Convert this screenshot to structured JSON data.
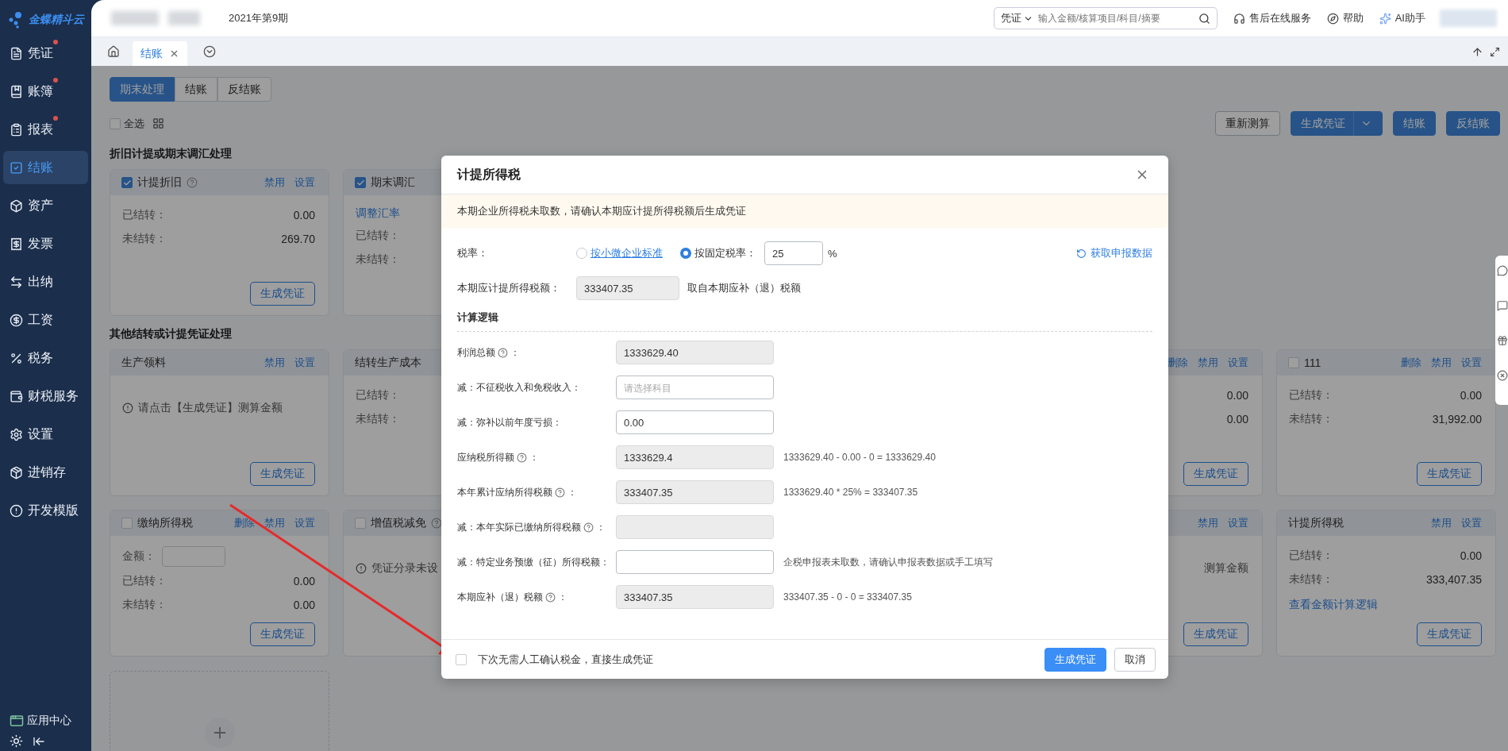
{
  "logo": {
    "text": "金蝶精斗云"
  },
  "sidebar": {
    "items": [
      {
        "label": "凭证",
        "badge": true,
        "selected": false
      },
      {
        "label": "账簿",
        "badge": true,
        "selected": false
      },
      {
        "label": "报表",
        "badge": true,
        "selected": false
      },
      {
        "label": "结账",
        "badge": false,
        "selected": true
      },
      {
        "label": "资产",
        "badge": false,
        "selected": false
      },
      {
        "label": "发票",
        "badge": false,
        "selected": false
      },
      {
        "label": "出纳",
        "badge": false,
        "selected": false
      },
      {
        "label": "工资",
        "badge": false,
        "selected": false
      },
      {
        "label": "税务",
        "badge": false,
        "selected": false
      },
      {
        "label": "财税服务",
        "badge": false,
        "selected": false
      },
      {
        "label": "设置",
        "badge": false,
        "selected": false
      },
      {
        "label": "进销存",
        "badge": false,
        "selected": false
      },
      {
        "label": "开发模版",
        "badge": false,
        "selected": false
      }
    ],
    "footer": {
      "label": "应用中心"
    }
  },
  "topbar": {
    "period": "2021年第9期",
    "search": {
      "scope": "凭证",
      "placeholder": "输入金额/核算项目/科目/摘要"
    },
    "links": [
      "售后在线服务",
      "帮助",
      "AI助手"
    ]
  },
  "tabs": [
    {
      "label": "结账",
      "selected": true
    }
  ],
  "mode_tabs": [
    {
      "label": "期末处理",
      "selected": true
    },
    {
      "label": "结账",
      "selected": false
    },
    {
      "label": "反结账",
      "selected": false
    }
  ],
  "select_all": {
    "label": "全选",
    "checked": false
  },
  "actions": [
    {
      "label": "重新测算",
      "kind": "outline"
    },
    {
      "label": "生成凭证",
      "kind": "split"
    },
    {
      "label": "结账",
      "kind": "primary"
    },
    {
      "label": "反结账",
      "kind": "primary"
    }
  ],
  "sections": [
    {
      "title": "折旧计提或期末调汇处理",
      "cards": [
        {
          "kind": "full",
          "title": "计提折旧",
          "checked": true,
          "help": true,
          "links": [
            "禁用",
            "设置"
          ],
          "rows": [
            {
              "label": "已结转：",
              "value": "0.00"
            },
            {
              "label": "未结转：",
              "value": "269.70"
            }
          ],
          "button": "生成凭证"
        },
        {
          "kind": "partial_left",
          "title": "期末调汇",
          "checked": true,
          "link": "调整汇率",
          "rows": [
            {
              "label": "已结转："
            },
            {
              "label": "未结转："
            }
          ]
        }
      ]
    },
    {
      "title": "其他结转或计提凭证处理",
      "cards": [
        {
          "kind": "full",
          "title": "生产领料",
          "links": [
            "禁用",
            "设置"
          ],
          "notice": "请点击【生成凭证】测算金额",
          "button": "生成凭证"
        },
        {
          "kind": "partial_left",
          "title": "结转生产成本",
          "rows": [
            {
              "label": "已结转："
            },
            {
              "label": "未结转："
            }
          ]
        },
        {
          "kind": "covered"
        },
        {
          "kind": "covered"
        },
        {
          "kind": "partial_right",
          "links": [
            "删除",
            "禁用",
            "设置"
          ],
          "rows": [
            {
              "value": "0.00"
            },
            {
              "value": "0.00"
            }
          ],
          "button": "生成凭证"
        },
        {
          "kind": "full",
          "title": "111",
          "checked": false,
          "links": [
            "删除",
            "禁用",
            "设置"
          ],
          "rows": [
            {
              "label": "已结转：",
              "value": "0.00"
            },
            {
              "label": "未结转：",
              "value": "31,992.00"
            }
          ],
          "button": "生成凭证"
        },
        {
          "kind": "full",
          "title": "缴纳所得税",
          "checked": false,
          "links": [
            "删除",
            "禁用",
            "设置"
          ],
          "amount": {
            "label": "金额："
          },
          "rows": [
            {
              "label": "已结转：",
              "value": "0.00"
            },
            {
              "label": "未结转：",
              "value": "0.00"
            }
          ],
          "button": "生成凭证"
        },
        {
          "kind": "partial_left",
          "title": "增值税减免",
          "checked": false,
          "help": true,
          "notice": "凭证分录未设"
        },
        {
          "kind": "covered"
        },
        {
          "kind": "covered"
        },
        {
          "kind": "partial_right",
          "links": [
            "禁用",
            "设置"
          ],
          "notice": "测算金额",
          "button": "生成凭证"
        },
        {
          "kind": "full",
          "title": "计提所得税",
          "links": [
            "禁用",
            "设置"
          ],
          "rows": [
            {
              "label": "已结转：",
              "value": "0.00"
            },
            {
              "label": "未结转：",
              "value": "333,407.35"
            }
          ],
          "link": "查看金额计算逻辑",
          "button": "生成凭证"
        }
      ]
    }
  ],
  "dialog": {
    "title": "计提所得税",
    "notice": "本期企业所得税未取数，请确认本期应计提所得税额后生成凭证",
    "rate": {
      "label": "税率：",
      "options": [
        {
          "label": "按小微企业标准",
          "kind": "link",
          "selected": false
        },
        {
          "label": "按固定税率：",
          "kind": "plain",
          "selected": true
        }
      ],
      "value": "25",
      "unit": "%"
    },
    "fetch_link": "获取申报数据",
    "provision": {
      "label": "本期应计提所得税额：",
      "value": "333407.35",
      "note": "取自本期应补（退）税额"
    },
    "logic_title": "计算逻辑",
    "rows": [
      {
        "label": "利润总额",
        "help": true,
        "suffix": "：",
        "value": "1333629.40",
        "disabled": true
      },
      {
        "label": "减：不征税收入和免税收入：",
        "help": false,
        "placeholder": "请选择科目",
        "disabled": false
      },
      {
        "label": "减：弥补以前年度亏损：",
        "help": false,
        "value": "0.00",
        "disabled": false
      },
      {
        "label": "应纳税所得额",
        "help": true,
        "suffix": "：",
        "value": "1333629.4",
        "disabled": true,
        "formula": "1333629.40 - 0.00 - 0 = 1333629.40"
      },
      {
        "label": "本年累计应纳所得税额",
        "help": true,
        "suffix": "：",
        "value": "333407.35",
        "disabled": true,
        "formula": "1333629.40 * 25% = 333407.35"
      },
      {
        "label": "减：本年实际已缴纳所得税额",
        "help": true,
        "suffix": "：",
        "disabled": true
      },
      {
        "label": "减：特定业务预缴（征）所得税额：",
        "help": false,
        "disabled": false,
        "formula": "企税申报表未取数，请确认申报表数据或手工填写"
      },
      {
        "label": "本期应补（退）税额",
        "help": true,
        "suffix": "：",
        "value": "333407.35",
        "disabled": true,
        "formula": "333407.35 - 0 - 0 = 333407.35"
      }
    ],
    "footer": {
      "checkbox": {
        "label": "下次无需人工确认税金，直接生成凭证",
        "checked": false
      },
      "buttons": [
        {
          "label": "生成凭证",
          "kind": "primary"
        },
        {
          "label": "取消",
          "kind": "default"
        }
      ]
    }
  }
}
